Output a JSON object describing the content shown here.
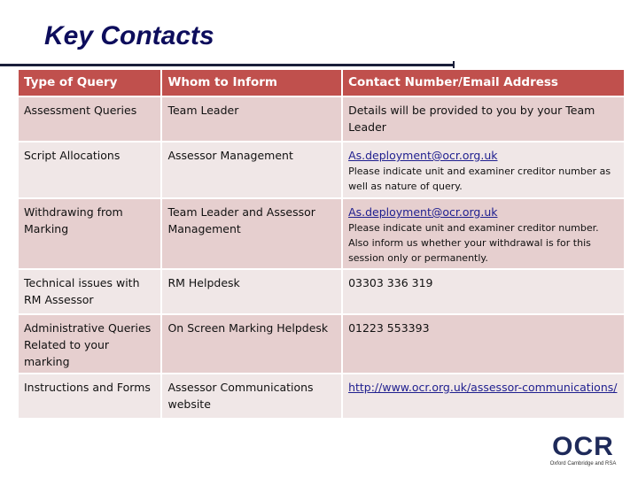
{
  "page": {
    "title": "Key Contacts"
  },
  "table": {
    "headers": [
      "Type of Query",
      "Whom to Inform",
      "Contact Number/Email Address"
    ],
    "rows": [
      {
        "query": "Assessment Queries",
        "whom": "Team Leader",
        "contact": "Details will be provided to you by your Team Leader",
        "contact_link": "",
        "note": ""
      },
      {
        "query": "Script Allocations",
        "whom": "Assessor Management",
        "contact": "",
        "contact_link": "As.deployment@ocr.org.uk",
        "note": "Please indicate unit and examiner creditor number as well as nature of query."
      },
      {
        "query": "Withdrawing from Marking",
        "whom": "Team Leader and Assessor Management",
        "contact": "",
        "contact_link": "As.deployment@ocr.org.uk",
        "note": "Please indicate unit and examiner creditor number. Also inform us whether your withdrawal is for this session only or permanently."
      },
      {
        "query": "Technical issues with RM Assessor",
        "whom": "RM Helpdesk",
        "contact": "03303 336 319",
        "contact_link": "",
        "note": ""
      },
      {
        "query": "Administrative Queries Related to your marking",
        "whom": "On Screen Marking Helpdesk",
        "contact": "01223 553393",
        "contact_link": "",
        "note": ""
      },
      {
        "query": "Instructions and Forms",
        "whom": "Assessor Communications website",
        "contact": "",
        "contact_link": "http://www.ocr.org.uk/assessor-communications/",
        "note": ""
      }
    ]
  },
  "logo": {
    "mark": "OCR",
    "subtitle": "Oxford Cambridge and RSA"
  },
  "colors": {
    "title": "#0d0d5c",
    "header_bg": "#c0504d",
    "row_odd_bg": "#e6cfcf",
    "row_even_bg": "#f0e7e7",
    "link": "#1f1f8f"
  }
}
